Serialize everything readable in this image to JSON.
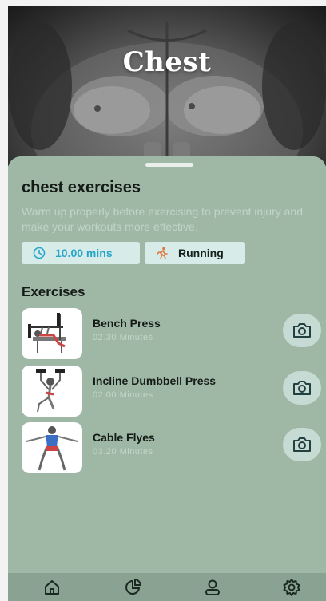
{
  "hero": {
    "title": "Chest"
  },
  "sheet": {
    "title": "chest exercises",
    "description": "Warm up properly before exercising to prevent injury and make your workouts more effective.",
    "chips": [
      {
        "icon": "clock-icon",
        "label": "10.00 mins",
        "color": "#27a5c8"
      },
      {
        "icon": "running-icon",
        "label": "Running",
        "icon_color": "#e07a3f"
      }
    ],
    "section_title": "Exercises",
    "exercises": [
      {
        "name": "Bench Press",
        "duration": "02.30 Minutes"
      },
      {
        "name": "Incline Dumbbell Press",
        "duration": "02.00 Minutes"
      },
      {
        "name": "Cable Flyes",
        "duration": "03.20 Minutes"
      }
    ]
  },
  "nav": {
    "items": [
      "home-icon",
      "chart-icon",
      "profile-icon",
      "settings-icon"
    ]
  },
  "colors": {
    "background": "#9fb8a5",
    "nav": "#89a291",
    "chip": "#d7ece9",
    "camera_button": "#c6dbd4"
  }
}
